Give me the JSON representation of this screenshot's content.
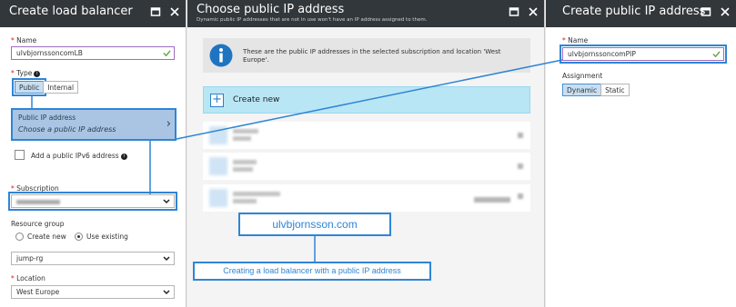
{
  "blade1": {
    "title": "Create load balancer",
    "name_label": "Name",
    "name_value": "ulvbjornssoncomLB",
    "type_label": "Type",
    "type_options": [
      "Public",
      "Internal"
    ],
    "pip_label": "Public IP address",
    "pip_value": "Choose a public IP address",
    "ipv6_label": "Add a public IPv6 address",
    "subscription_label": "Subscription",
    "rg_label": "Resource group",
    "rg_create": "Create new",
    "rg_existing": "Use existing",
    "rg_value": "jump-rg",
    "location_label": "Location",
    "location_value": "West Europe"
  },
  "blade2": {
    "title": "Choose public IP address",
    "subtitle": "Dynamic public IP addresses that are not in use won't have an IP address assigned to them.",
    "info_text": "These are the public IP addresses in the selected subscription and location 'West Europe'.",
    "create_new": "Create new"
  },
  "blade3": {
    "title": "Create public IP address",
    "name_label": "Name",
    "name_value": "ulvbjornssoncomPIP",
    "assignment_label": "Assignment",
    "assignment_options": [
      "Dynamic",
      "Static"
    ]
  },
  "watermark": "ulvbjornsson.com",
  "caption": "Creating a load balancer with a public IP address",
  "colors": {
    "header": "#32373b",
    "accent": "#2f85d5",
    "highlight": "#b9e6f5",
    "required": "#e81123"
  }
}
